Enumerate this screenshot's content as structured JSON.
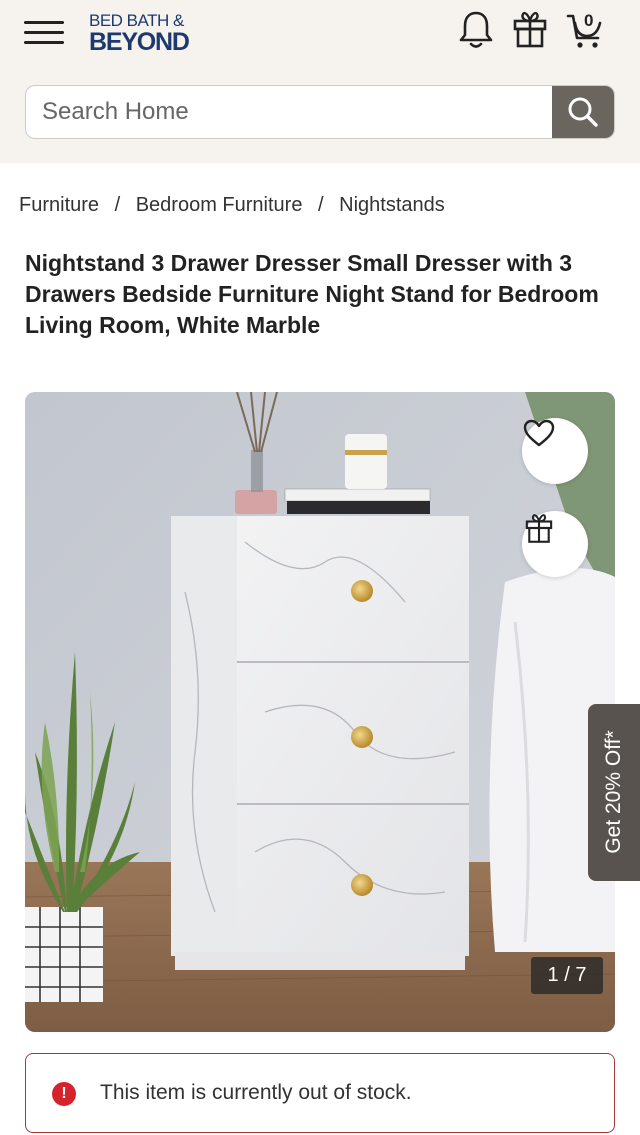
{
  "header": {
    "logo_line1": "BED BATH &",
    "logo_line2": "BEYOND",
    "icons": [
      "menu-icon",
      "bell-icon",
      "gift-icon",
      "cart-icon"
    ],
    "cart_count": "0"
  },
  "search": {
    "placeholder": "Search Home",
    "value": ""
  },
  "breadcrumb": {
    "items": [
      "Furniture",
      "Bedroom Furniture",
      "Nightstands"
    ],
    "separator": "/"
  },
  "product": {
    "title": "Nightstand 3 Drawer Dresser Small Dresser with 3 Drawers Bedside Furniture Night Stand for Bedroom Living Room, White Marble"
  },
  "gallery": {
    "counter": "1 / 7",
    "current_image": 1,
    "total_images": 7
  },
  "promo": {
    "label": "Get 20% Off*"
  },
  "stock_alert": {
    "icon": "!",
    "message": "This item is currently out of stock."
  },
  "colors": {
    "header_bg": "#f6f3ef",
    "logo_blue": "#1d3a6e",
    "search_button": "#6b6560",
    "promo_tab": "#58534e",
    "alert_red": "#d6232b",
    "alert_border": "#a33a3a"
  }
}
